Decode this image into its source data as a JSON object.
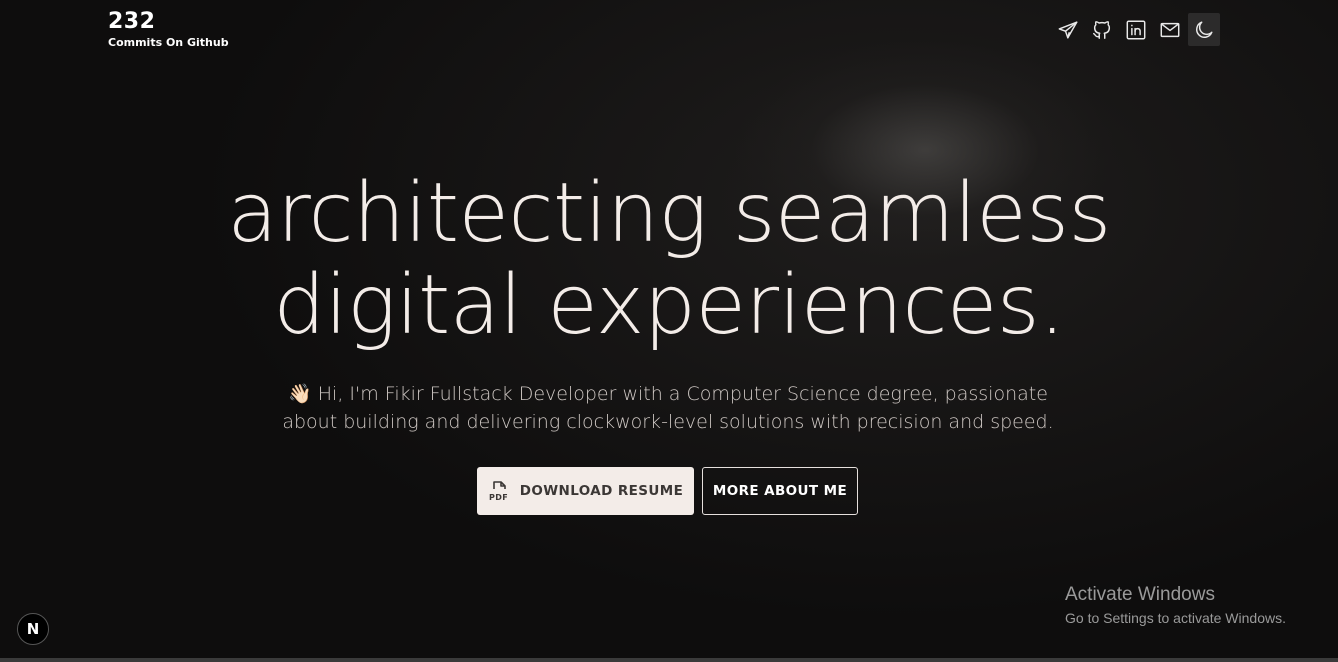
{
  "github": {
    "commit_count": "232",
    "commit_label": "Commits On Github"
  },
  "social_icons": [
    {
      "icon": "telegram-icon"
    },
    {
      "icon": "github-icon"
    },
    {
      "icon": "linkedin-icon"
    },
    {
      "icon": "mail-icon"
    },
    {
      "icon": "moon-icon"
    }
  ],
  "hero": {
    "headline_line1": "architecting seamless",
    "headline_line2": "digital experiences.",
    "wave_emoji": "👋🏻",
    "intro_text": "Hi, I'm Fikir Fullstack Developer with a Computer Science degree, passionate about building and delivering clockwork-level solutions with precision and speed."
  },
  "buttons": {
    "resume_label": "DOWNLOAD RESUME",
    "pdf_icon_text": "PDF",
    "about_label": "MORE ABOUT ME"
  },
  "windows_watermark": {
    "title": "Activate Windows",
    "subtitle": "Go to Settings to activate Windows."
  },
  "next_badge": {
    "letter": "N"
  },
  "colors": {
    "background": "#0e0d0d",
    "headline": "#f3ece8",
    "resume_button_bg": "#f3ece8",
    "resume_button_text": "#3b3735"
  }
}
